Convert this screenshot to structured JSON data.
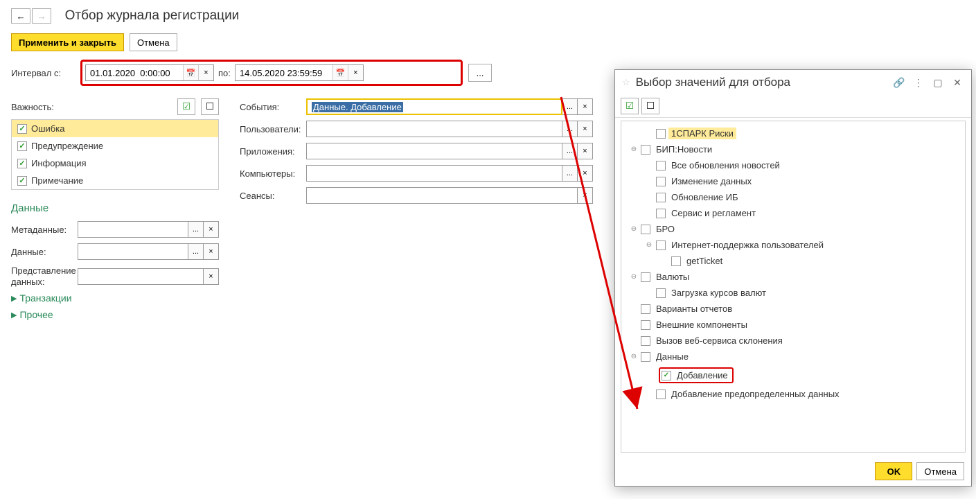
{
  "title": "Отбор журнала регистрации",
  "toolbar": {
    "apply": "Применить и закрыть",
    "cancel": "Отмена"
  },
  "interval": {
    "label": "Интервал с:",
    "from": "01.01.2020  0:00:00",
    "to_label": "по:",
    "to": "14.05.2020 23:59:59",
    "more": "..."
  },
  "importance": {
    "label": "Важность:",
    "items": [
      "Ошибка",
      "Предупреждение",
      "Информация",
      "Примечание"
    ]
  },
  "filters": {
    "events": {
      "label": "События:",
      "value": "Данные. Добавление"
    },
    "users": {
      "label": "Пользователи:",
      "value": ""
    },
    "apps": {
      "label": "Приложения:",
      "value": ""
    },
    "computers": {
      "label": "Компьютеры:",
      "value": ""
    },
    "sessions": {
      "label": "Сеансы:",
      "value": ""
    }
  },
  "data_section": {
    "title": "Данные",
    "metadata": {
      "label": "Метаданные:",
      "value": ""
    },
    "data": {
      "label": "Данные:",
      "value": ""
    },
    "representation": {
      "label": "Представление данных:",
      "value": ""
    },
    "transactions": "Транзакции",
    "other": "Прочее"
  },
  "modal": {
    "title": "Выбор значений для отбора",
    "ok": "OK",
    "cancel": "Отмена",
    "tree": [
      {
        "indent": 1,
        "exp": "",
        "checked": false,
        "label": "1СПАРК Риски",
        "hl": true
      },
      {
        "indent": 0,
        "exp": "⊖",
        "checked": false,
        "label": "БИП:Новости"
      },
      {
        "indent": 1,
        "exp": "",
        "checked": false,
        "label": "Все обновления новостей"
      },
      {
        "indent": 1,
        "exp": "",
        "checked": false,
        "label": "Изменение данных"
      },
      {
        "indent": 1,
        "exp": "",
        "checked": false,
        "label": "Обновление ИБ"
      },
      {
        "indent": 1,
        "exp": "",
        "checked": false,
        "label": "Сервис и регламент"
      },
      {
        "indent": 0,
        "exp": "⊖",
        "checked": false,
        "label": "БРО"
      },
      {
        "indent": 1,
        "exp": "⊖",
        "checked": false,
        "label": "Интернет-поддержка пользователей"
      },
      {
        "indent": 2,
        "exp": "",
        "checked": false,
        "label": "getTicket"
      },
      {
        "indent": 0,
        "exp": "⊖",
        "checked": false,
        "label": "Валюты"
      },
      {
        "indent": 1,
        "exp": "",
        "checked": false,
        "label": "Загрузка курсов валют"
      },
      {
        "indent": 0,
        "exp": "",
        "checked": false,
        "label": "Варианты отчетов"
      },
      {
        "indent": 0,
        "exp": "",
        "checked": false,
        "label": "Внешние компоненты"
      },
      {
        "indent": 0,
        "exp": "",
        "checked": false,
        "label": "Вызов веб-сервиса склонения"
      },
      {
        "indent": 0,
        "exp": "⊖",
        "checked": false,
        "label": "Данные"
      },
      {
        "indent": 1,
        "exp": "",
        "checked": true,
        "label": "Добавление",
        "red": true
      },
      {
        "indent": 1,
        "exp": "",
        "checked": false,
        "label": "Добавление предопределенных данных"
      }
    ]
  }
}
